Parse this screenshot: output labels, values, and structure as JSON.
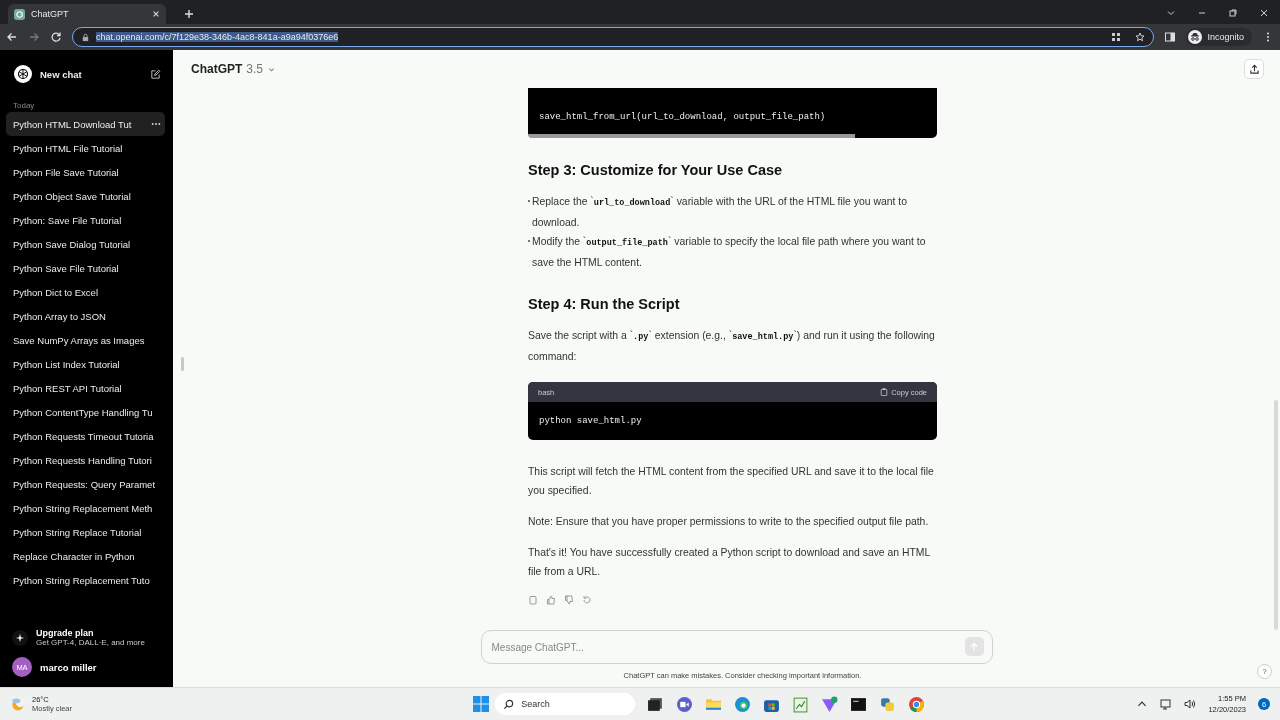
{
  "browser": {
    "tab": {
      "title": "ChatGPT"
    },
    "url": "chat.openai.com/c/7f129e38-346b-4ac8-841a-a9a94f0376e6",
    "profile": "Incognito"
  },
  "sidebar": {
    "new_chat": "New chat",
    "section": "Today",
    "items": [
      {
        "label": "Python HTML Download Tut",
        "selected": true
      },
      {
        "label": "Python HTML File Tutorial",
        "selected": false
      },
      {
        "label": "Python File Save Tutorial",
        "selected": false
      },
      {
        "label": "Python Object Save Tutorial",
        "selected": false
      },
      {
        "label": "Python: Save File Tutorial",
        "selected": false
      },
      {
        "label": "Python Save Dialog Tutorial",
        "selected": false
      },
      {
        "label": "Python Save File Tutorial",
        "selected": false
      },
      {
        "label": "Python Dict to Excel",
        "selected": false
      },
      {
        "label": "Python Array to JSON",
        "selected": false
      },
      {
        "label": "Save NumPy Arrays as Images",
        "selected": false
      },
      {
        "label": "Python List Index Tutorial",
        "selected": false
      },
      {
        "label": "Python REST API Tutorial",
        "selected": false
      },
      {
        "label": "Python ContentType Handling Tu",
        "selected": false
      },
      {
        "label": "Python Requests Timeout Tutoria",
        "selected": false
      },
      {
        "label": "Python Requests Handling Tutori",
        "selected": false
      },
      {
        "label": "Python Requests: Query Paramet",
        "selected": false
      },
      {
        "label": "Python String Replacement Meth",
        "selected": false
      },
      {
        "label": "Python String Replace Tutorial",
        "selected": false
      },
      {
        "label": "Replace Character in Python",
        "selected": false
      },
      {
        "label": "Python String Replacement Tuto",
        "selected": false
      }
    ],
    "upgrade": {
      "title": "Upgrade plan",
      "subtitle": "Get GPT-4, DALL·E, and more"
    },
    "user": {
      "initials": "MA",
      "name": "marco miller"
    }
  },
  "header": {
    "model": "ChatGPT",
    "version": "3.5"
  },
  "content": [
    {
      "kind": "code",
      "code": "save_html_from_url(url_to_download, output_file_path)"
    },
    {
      "kind": "heading",
      "text": "Step 3: Customize for Your Use Case"
    },
    {
      "kind": "bullets",
      "items": [
        "Replace the `**url_to_download**` variable with the URL of the HTML file you want to download.",
        "Modify the `**output_file_path**` variable to specify the local file path where you want to save the HTML content."
      ]
    },
    {
      "kind": "heading",
      "text": "Step 4: Run the Script"
    },
    {
      "kind": "paragraph",
      "text": "Save the script with a `**.py**` extension (e.g., `**save_html.py**`) and run it using the following command:"
    },
    {
      "kind": "codeblock",
      "language": "bash",
      "copy": "Copy code",
      "code": "python save_html.py"
    },
    {
      "kind": "paragraph",
      "text": "This script will fetch the HTML content from the specified URL and save it to the local file you specified."
    },
    {
      "kind": "paragraph",
      "text": "Note: Ensure that you have proper permissions to write to the specified output file path."
    },
    {
      "kind": "paragraph",
      "text": "That's it! You have successfully created a Python script to download and save an HTML file from a URL."
    }
  ],
  "composer": {
    "placeholder": "Message ChatGPT...",
    "disclaimer": "ChatGPT can make mistakes. Consider checking important information.",
    "help": "?"
  },
  "taskbar": {
    "temperature": "26°C",
    "weather": "Mostly clear",
    "search": "Search",
    "time": "1:55 PM",
    "date": "12/20/2023",
    "notifications": "6"
  }
}
